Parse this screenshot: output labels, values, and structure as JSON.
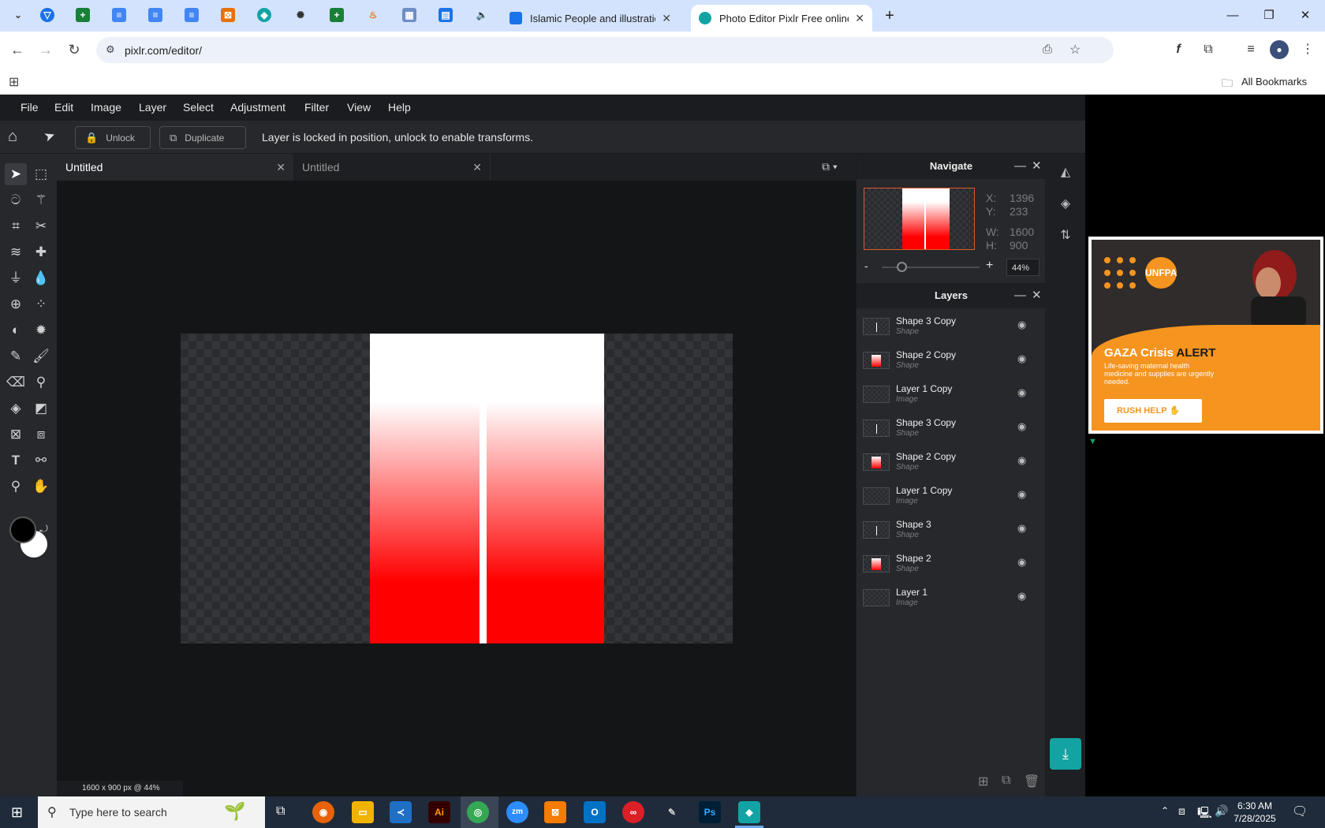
{
  "browser": {
    "tabs": [
      {
        "label": "Islamic People and illustration v",
        "icon": "docs-icon"
      },
      {
        "label": "Photo Editor Pixlr Free online In",
        "icon": "pixlr-icon",
        "active": true
      }
    ],
    "pinned_icons": [
      "vpn-icon",
      "sheets-icon",
      "docs-icon",
      "docs-icon",
      "docs-icon",
      "office-icon",
      "app-icon",
      "chatgpt-icon",
      "sheets-icon",
      "app-icon",
      "qr-icon",
      "forms-icon",
      "audio-icon"
    ],
    "url": "pixlr.com/editor/",
    "bookmarks_label": "All Bookmarks"
  },
  "pixlr": {
    "menu": [
      "File",
      "Edit",
      "Image",
      "Layer",
      "Select",
      "Adjustment",
      "Filter",
      "View",
      "Help"
    ],
    "options": {
      "unlock_label": "Unlock",
      "duplicate_label": "Duplicate",
      "lock_message": "Layer is locked in position, unlock to enable transforms."
    },
    "doc_tabs": [
      "Untitled",
      "Untitled"
    ],
    "status": "1600 x 900 px @ 44%",
    "navigate": {
      "title": "Navigate",
      "x_label": "X:",
      "x": "1396",
      "y_label": "Y:",
      "y": "233",
      "w_label": "W:",
      "w": "1600",
      "h_label": "H:",
      "h": "900",
      "zoom": "44%",
      "zoom_minus": "-",
      "zoom_plus": "+",
      "zoom_level": 0.2
    },
    "layers": {
      "title": "Layers",
      "items": [
        {
          "name": "Shape 3 Copy",
          "type": "Shape"
        },
        {
          "name": "Shape 2 Copy",
          "type": "Shape"
        },
        {
          "name": "Layer 1 Copy",
          "type": "Image"
        },
        {
          "name": "Shape 3 Copy",
          "type": "Shape"
        },
        {
          "name": "Shape 2 Copy",
          "type": "Shape"
        },
        {
          "name": "Layer 1 Copy",
          "type": "Image"
        },
        {
          "name": "Shape 3",
          "type": "Shape"
        },
        {
          "name": "Shape 2",
          "type": "Shape"
        },
        {
          "name": "Layer 1",
          "type": "Image"
        }
      ]
    }
  },
  "ad": {
    "brand": "UNFPA",
    "headline_a": "GAZA Crisis",
    "headline_b": "ALERT",
    "body": "Life-saving maternal health medicine and supplies are urgently needed.",
    "cta": "RUSH HELP"
  },
  "taskbar": {
    "search_placeholder": "Type here to search",
    "time": "6:30 AM",
    "date": "7/28/2025"
  },
  "colors": {
    "accent_teal": "#14a3a3",
    "ad_orange": "#f5941f",
    "canvas_red": "#ff0000"
  }
}
